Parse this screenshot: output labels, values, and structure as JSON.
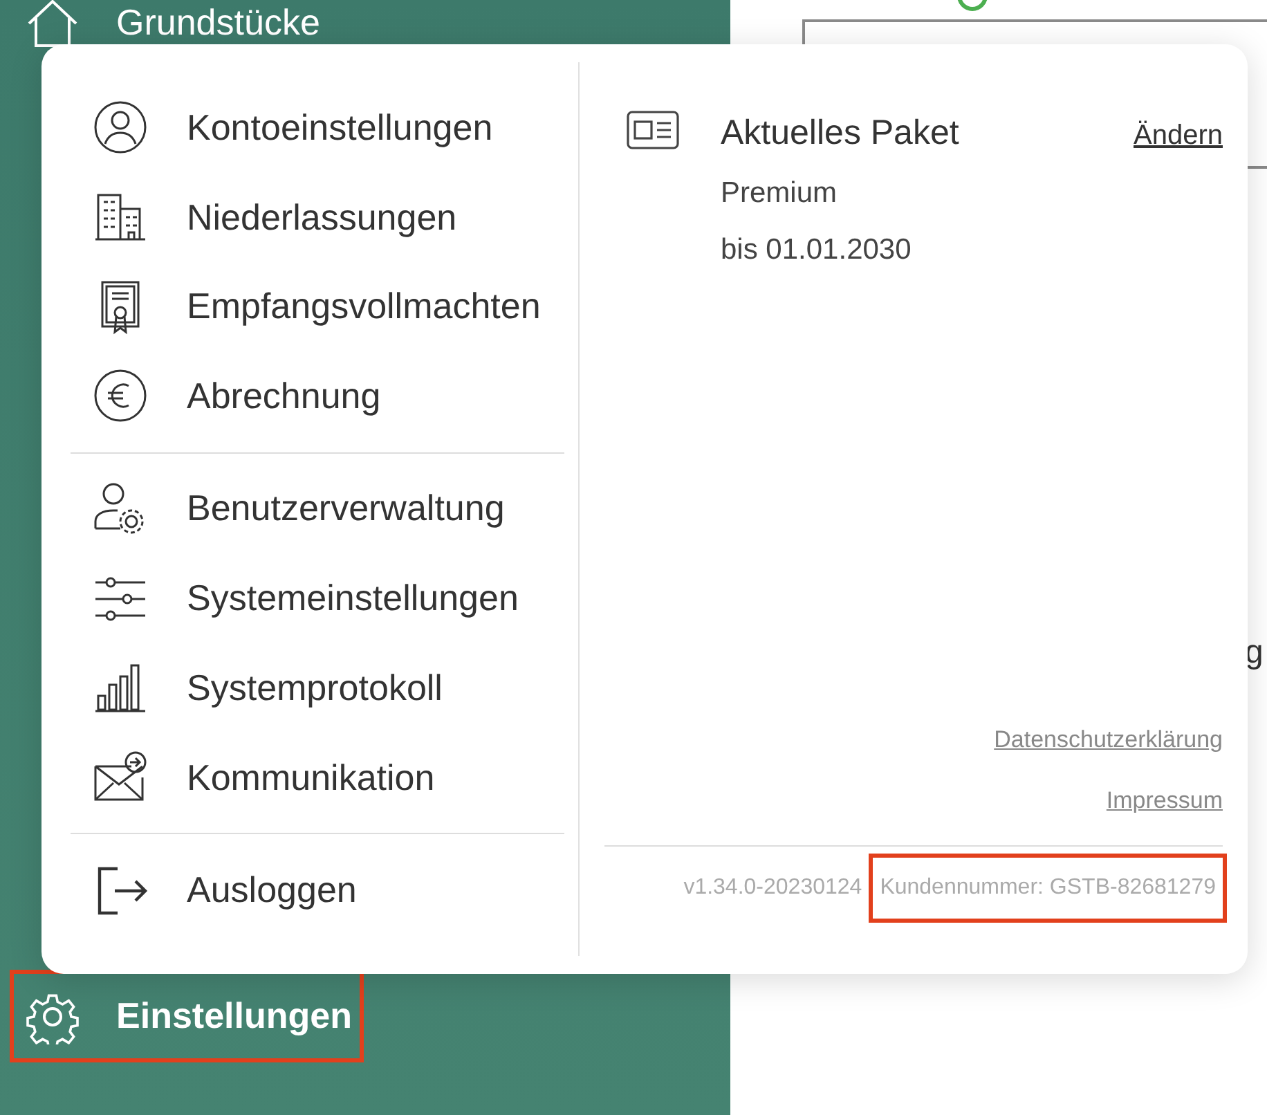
{
  "sidebar": {
    "items": [
      {
        "label": "Grundstücke",
        "kind": "home",
        "selected": false,
        "highlighted": false
      },
      {
        "label": "Einstellungen",
        "kind": "gear",
        "selected": true,
        "highlighted": true
      }
    ]
  },
  "settings_menu": {
    "groups": [
      [
        {
          "label": "Kontoeinstellungen",
          "kind": "account"
        },
        {
          "label": "Niederlassungen",
          "kind": "branches"
        },
        {
          "label": "Empfangsvollmachten",
          "kind": "authorization"
        },
        {
          "label": "Abrechnung",
          "kind": "billing"
        }
      ],
      [
        {
          "label": "Benutzerverwaltung",
          "kind": "users"
        },
        {
          "label": "Systemeinstellungen",
          "kind": "system"
        },
        {
          "label": "Systemprotokoll",
          "kind": "log"
        },
        {
          "label": "Kommunikation",
          "kind": "communication"
        }
      ],
      [
        {
          "label": "Ausloggen",
          "kind": "logout"
        }
      ]
    ],
    "package": {
      "title": "Aktuelles Paket",
      "change_link": "Ändern",
      "plan": "Premium",
      "valid_until": "bis 01.01.2030"
    },
    "links": [
      "Datenschutzerklärung",
      "Impressum"
    ],
    "version": "v1.34.0-20230124",
    "customer_number": {
      "text": "Kundennummer: GSTB-82681279",
      "highlighted": true
    }
  },
  "background_text": "g"
}
